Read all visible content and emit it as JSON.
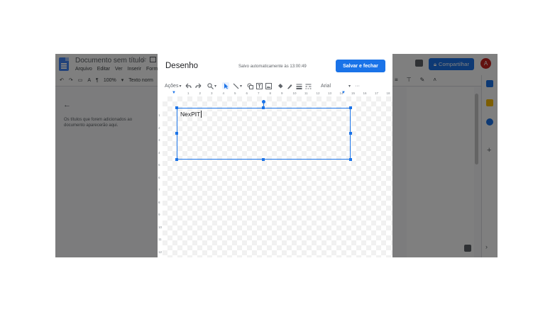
{
  "docs": {
    "title": "Documento sem título",
    "menus": [
      "Arquivo",
      "Editar",
      "Ver",
      "Inserir",
      "Format"
    ],
    "zoom": "100%",
    "style": "Texto norm",
    "share_label": "Compartilhar",
    "avatar_initial": "A",
    "outline_hint": "Os títulos que forem adicionados ao documento aparecerão aqui."
  },
  "dialog": {
    "title": "Desenho",
    "autosave": "Salvo automaticamente às 13:00:49",
    "save_close_label": "Salvar e fechar",
    "toolbar": {
      "actions_label": "Ações",
      "font": "Arial",
      "more": "···"
    },
    "ruler_h_ticks": [
      "1",
      "2",
      "3",
      "4",
      "5",
      "6",
      "7",
      "8",
      "9",
      "10",
      "11",
      "12",
      "13",
      "14",
      "15",
      "16",
      "17",
      "18"
    ],
    "ruler_v_ticks": [
      "1",
      "2",
      "3",
      "4",
      "5",
      "6",
      "7",
      "8",
      "9",
      "10",
      "11",
      "12"
    ],
    "textbox_text": "NexPIT"
  },
  "colors": {
    "accent": "#1a73e8",
    "avatar": "#c5221f"
  }
}
